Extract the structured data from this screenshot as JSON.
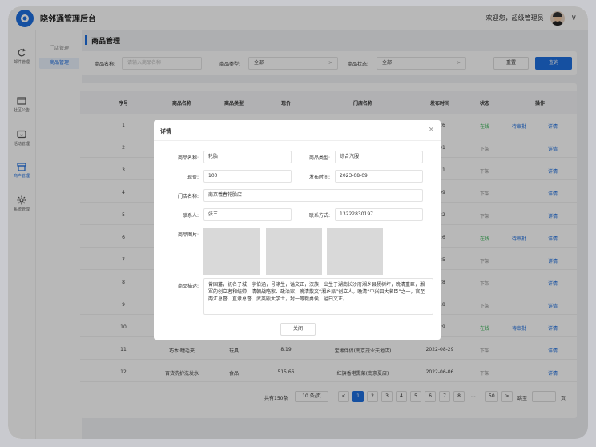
{
  "app": {
    "title": "晓邻通管理后台",
    "welcome": "欢迎您，超级管理员"
  },
  "iconbar": [
    {
      "label": "邮件管理",
      "icon": "refresh-icon"
    },
    {
      "label": "社区公告",
      "icon": "window-icon"
    },
    {
      "label": "活动管理",
      "icon": "chat-icon"
    },
    {
      "label": "商户管理",
      "icon": "store-icon"
    },
    {
      "label": "系统管理",
      "icon": "gear-icon"
    }
  ],
  "subnav": [
    {
      "label": "门店管理"
    },
    {
      "label": "商品管理"
    }
  ],
  "page": {
    "title": "商品管理"
  },
  "filters": {
    "name_label": "商品名称:",
    "name_placeholder": "请输入商品名称",
    "type_label": "商品类型:",
    "type_value": "全部",
    "status_label": "商品状态:",
    "status_value": "全部",
    "reset": "重置",
    "search": "查询"
  },
  "table": {
    "headers": [
      "序号",
      "商品名称",
      "商品类型",
      "现价",
      "门店名称",
      "发布时间",
      "状态",
      "操作"
    ],
    "rows": [
      {
        "no": "1",
        "name": "",
        "type": "",
        "price": "",
        "store": "",
        "date": "7-26",
        "status": "在线",
        "approve": "待审批",
        "detail": "详情"
      },
      {
        "no": "2",
        "name": "",
        "type": "",
        "price": "",
        "store": "",
        "date": "9-01",
        "status": "下架",
        "approve": "",
        "detail": "详情"
      },
      {
        "no": "3",
        "name": "E",
        "type": "",
        "price": "",
        "store": "",
        "date": "6-11",
        "status": "下架",
        "approve": "",
        "detail": "详情"
      },
      {
        "no": "4",
        "name": "F",
        "type": "",
        "price": "",
        "store": "",
        "date": "0-09",
        "status": "下架",
        "approve": "",
        "detail": "详情"
      },
      {
        "no": "5",
        "name": "",
        "type": "",
        "price": "",
        "store": "",
        "date": "6-22",
        "status": "下架",
        "approve": "",
        "detail": "详情"
      },
      {
        "no": "6",
        "name": "E",
        "type": "",
        "price": "",
        "store": "",
        "date": "7-26",
        "status": "在线",
        "approve": "待审批",
        "detail": "详情"
      },
      {
        "no": "7",
        "name": "",
        "type": "",
        "price": "",
        "store": "",
        "date": "7-25",
        "status": "下架",
        "approve": "",
        "detail": "详情"
      },
      {
        "no": "8",
        "name": "",
        "type": "",
        "price": "",
        "store": "",
        "date": "8-28",
        "status": "下架",
        "approve": "",
        "detail": "详情"
      },
      {
        "no": "9",
        "name": "",
        "type": "",
        "price": "",
        "store": "",
        "date": "5-18",
        "status": "下架",
        "approve": "",
        "detail": "详情"
      },
      {
        "no": "10",
        "name": "",
        "type": "",
        "price": "",
        "store": "",
        "date": "8-29",
        "status": "在线",
        "approve": "待审批",
        "detail": "详情"
      },
      {
        "no": "11",
        "name": "巧本·睫毛夹",
        "type": "玩具",
        "price": "8.19",
        "store": "宝湘伴侣(南京茂业天地店)",
        "date": "2022-08-29",
        "status": "下架",
        "approve": "",
        "detail": "详情"
      },
      {
        "no": "12",
        "name": "百货洗护洗发水",
        "type": "食品",
        "price": "515.66",
        "store": "红旗香港熏菜(南京夏店)",
        "date": "2022-06-06",
        "status": "下架",
        "approve": "",
        "detail": "详情"
      }
    ]
  },
  "pager": {
    "total": "共有150条",
    "page_size": "10 条/页",
    "pages": [
      "1",
      "2",
      "3",
      "4",
      "5",
      "6",
      "7",
      "8"
    ],
    "ellipsis": "···",
    "last": "50",
    "goto_label": "跳至",
    "goto_suffix": "页",
    "prev": "<",
    "next": ">"
  },
  "modal": {
    "title": "详情",
    "name_label": "商品名称:",
    "name_value": "轮胎",
    "type_label": "商品类型:",
    "type_value": "综合汽服",
    "price_label": "现价:",
    "price_value": "100",
    "date_label": "发布时间:",
    "date_value": "2023-08-09",
    "store_label": "门店名称:",
    "store_value": "南京羲春轮胎店",
    "contact_label": "联系人:",
    "contact_value": "张三",
    "phone_label": "联系方式:",
    "phone_value": "13222830197",
    "image_label": "商品图片:",
    "desc_label": "商品描述:",
    "desc_value": "曾国藩，初名子城，字伯涵，号涤生，谥文正，汉族，出生于湖南长沙府湘乡县杨树坪，晚清重臣，湘军的创立者和统帅，清朝战略家、政治家，晚清散文“湘乡派”创立人。晚清“中兴四大名臣”之一，官至两江总督、直隶总督、武英殿大学士，封一等毅勇侯，谥曰文正。",
    "close_label": "关闭"
  },
  "colors": {
    "accent": "#1e6fe0",
    "online": "#2fb150",
    "offline": "#999999"
  }
}
